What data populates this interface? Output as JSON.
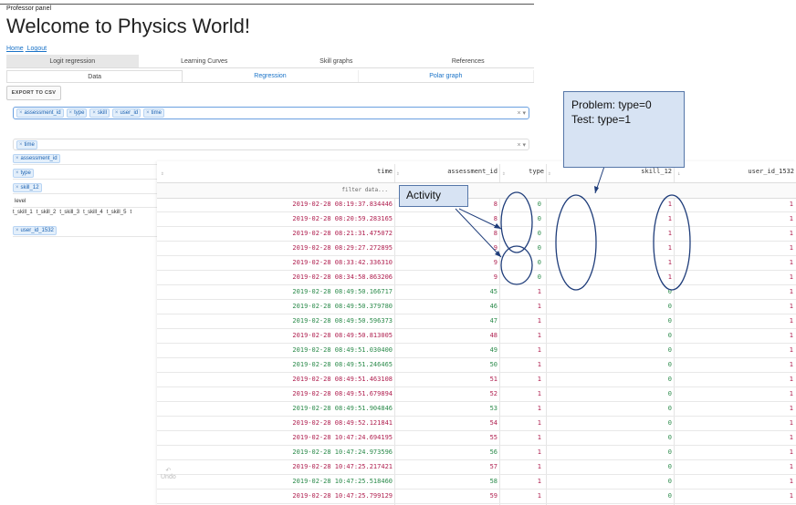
{
  "header": {
    "panel_label": "Professor panel",
    "title": "Welcome to Physics World!",
    "nav": [
      "Home",
      "Logout"
    ]
  },
  "tabs_primary": [
    {
      "label": "Logit regression",
      "active": true
    },
    {
      "label": "Learning Curves",
      "active": false
    },
    {
      "label": "Skill graphs",
      "active": false
    },
    {
      "label": "References",
      "active": false
    }
  ],
  "tabs_secondary": [
    {
      "label": "Data",
      "active": true
    },
    {
      "label": "Regression",
      "active": false
    },
    {
      "label": "Polar graph",
      "active": false
    }
  ],
  "export_label": "EXPORT TO CSV",
  "column_select": {
    "chips": [
      "assessment_id",
      "type",
      "skill",
      "user_id",
      "time"
    ],
    "clear": "× ▾"
  },
  "sidebar": {
    "time_chip": "time",
    "time_clear": "× ▾",
    "items": [
      "assessment_id",
      "type",
      "skill_12"
    ],
    "level_label": "level",
    "skills": [
      "t_skill_1",
      "t_skill_2",
      "t_skill_3",
      "t_skill_4",
      "t_skill_5",
      "t"
    ],
    "user_chip": "user_id_1532"
  },
  "table": {
    "headers": [
      "time",
      "assessment_id",
      "type",
      "skill_12",
      "user_id_1532"
    ],
    "sort_glyphs": [
      "⇕",
      "⇕",
      "⇕",
      "↓",
      ""
    ],
    "filter_placeholder": "filter data...",
    "rows": [
      {
        "time": "2019-02-28 08:19:37.834446",
        "assessment_id": "8",
        "type": "0",
        "skill_12": "1",
        "user_id_1532": "1"
      },
      {
        "time": "2019-02-28 08:20:59.283165",
        "assessment_id": "8",
        "type": "0",
        "skill_12": "1",
        "user_id_1532": "1"
      },
      {
        "time": "2019-02-28 08:21:31.475072",
        "assessment_id": "8",
        "type": "0",
        "skill_12": "1",
        "user_id_1532": "1"
      },
      {
        "time": "2019-02-28 08:29:27.272895",
        "assessment_id": "9",
        "type": "0",
        "skill_12": "1",
        "user_id_1532": "1"
      },
      {
        "time": "2019-02-28 08:33:42.336310",
        "assessment_id": "9",
        "type": "0",
        "skill_12": "1",
        "user_id_1532": "1"
      },
      {
        "time": "2019-02-28 08:34:58.863206",
        "assessment_id": "9",
        "type": "0",
        "skill_12": "1",
        "user_id_1532": "1"
      },
      {
        "time": "2019-02-28 08:49:50.166717",
        "assessment_id": "45",
        "type": "1",
        "skill_12": "0",
        "user_id_1532": "1"
      },
      {
        "time": "2019-02-28 08:49:50.379780",
        "assessment_id": "46",
        "type": "1",
        "skill_12": "0",
        "user_id_1532": "1"
      },
      {
        "time": "2019-02-28 08:49:50.596373",
        "assessment_id": "47",
        "type": "1",
        "skill_12": "0",
        "user_id_1532": "1"
      },
      {
        "time": "2019-02-28 08:49:50.813005",
        "assessment_id": "48",
        "type": "1",
        "skill_12": "0",
        "user_id_1532": "1"
      },
      {
        "time": "2019-02-28 08:49:51.030400",
        "assessment_id": "49",
        "type": "1",
        "skill_12": "0",
        "user_id_1532": "1"
      },
      {
        "time": "2019-02-28 08:49:51.246465",
        "assessment_id": "50",
        "type": "1",
        "skill_12": "0",
        "user_id_1532": "1"
      },
      {
        "time": "2019-02-28 08:49:51.463108",
        "assessment_id": "51",
        "type": "1",
        "skill_12": "0",
        "user_id_1532": "1"
      },
      {
        "time": "2019-02-28 08:49:51.679894",
        "assessment_id": "52",
        "type": "1",
        "skill_12": "0",
        "user_id_1532": "1"
      },
      {
        "time": "2019-02-28 08:49:51.904846",
        "assessment_id": "53",
        "type": "1",
        "skill_12": "0",
        "user_id_1532": "1"
      },
      {
        "time": "2019-02-28 08:49:52.121841",
        "assessment_id": "54",
        "type": "1",
        "skill_12": "0",
        "user_id_1532": "1"
      },
      {
        "time": "2019-02-28 10:47:24.694195",
        "assessment_id": "55",
        "type": "1",
        "skill_12": "0",
        "user_id_1532": "1"
      },
      {
        "time": "2019-02-28 10:47:24.973596",
        "assessment_id": "56",
        "type": "1",
        "skill_12": "0",
        "user_id_1532": "1"
      },
      {
        "time": "2019-02-28 10:47:25.217421",
        "assessment_id": "57",
        "type": "1",
        "skill_12": "0",
        "user_id_1532": "1"
      },
      {
        "time": "2019-02-28 10:47:25.518460",
        "assessment_id": "58",
        "type": "1",
        "skill_12": "0",
        "user_id_1532": "1"
      },
      {
        "time": "2019-02-28 10:47:25.799129",
        "assessment_id": "59",
        "type": "1",
        "skill_12": "0",
        "user_id_1532": "1"
      }
    ]
  },
  "annotations": {
    "note_lines": [
      "Problem: type=0",
      "Test: type=1"
    ],
    "activity": "Activity",
    "color": "#1f3d7a"
  },
  "undo_label": "Undo",
  "undo_icon": "undo-icon"
}
